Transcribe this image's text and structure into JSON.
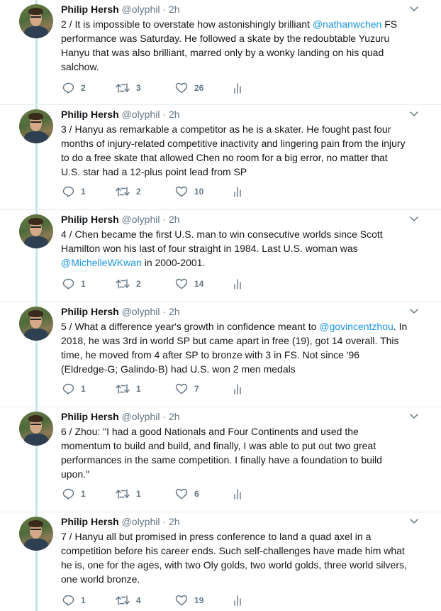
{
  "colors": {
    "thread_line": "#c4e4ec",
    "link": "#1b95e0",
    "meta": "#657786",
    "text": "#14171a"
  },
  "icons": {
    "reply": "reply-icon",
    "retweet": "retweet-icon",
    "like": "heart-icon",
    "analytics": "analytics-icon",
    "menu": "chevron-down-icon"
  },
  "tweets": [
    {
      "name": "Philip Hersh",
      "handle": "@olyphil",
      "dot": "·",
      "time": "2h",
      "text_parts": [
        "2 / It is impossible to overstate how astonishingly brilliant ",
        "@nathanwchen",
        " FS performance was Saturday.  He followed a skate by the redoubtable Yuzuru Hanyu that was also brilliant, marred only by a wonky landing on his quad salchow."
      ],
      "replies": "2",
      "retweets": "3",
      "likes": "26"
    },
    {
      "name": "Philip Hersh",
      "handle": "@olyphil",
      "dot": "·",
      "time": "2h",
      "text_parts": [
        "3 / Hanyu as remarkable a competitor as he is a skater.  He fought past four months of injury-related competitive inactivity and lingering pain from the injury to do a free skate that allowed Chen no room for a big error, no matter that U.S. star had a 12-plus point lead from SP",
        "",
        ""
      ],
      "replies": "1",
      "retweets": "2",
      "likes": "10"
    },
    {
      "name": "Philip Hersh",
      "handle": "@olyphil",
      "dot": "·",
      "time": "2h",
      "text_parts": [
        "4 / Chen became the first U.S. man to win consecutive worlds since Scott Hamilton won his last of four straight in 1984.  Last U.S. woman was ",
        "@MichelleWKwan",
        " in 2000-2001."
      ],
      "replies": "1",
      "retweets": "2",
      "likes": "14"
    },
    {
      "name": "Philip Hersh",
      "handle": "@olyphil",
      "dot": "·",
      "time": "2h",
      "text_parts": [
        "5 / What a difference year's growth in confidence meant to ",
        "@govincentzhou",
        ".  In 2018, he was 3rd in world SP but came apart in free (19), got 14 overall.  This time, he moved from 4 after SP to bronze with 3 in FS.  Not since '96 (Eldredge-G; Galindo-B) had U.S. won 2 men medals"
      ],
      "replies": "1",
      "retweets": "1",
      "likes": "7"
    },
    {
      "name": "Philip Hersh",
      "handle": "@olyphil",
      "dot": "·",
      "time": "2h",
      "text_parts": [
        "6 / Zhou:  \"I had a good Nationals and Four Continents and used the momentum to build and build, and finally, I was able to put out two great performances in the same competition.  I finally have a foundation to build upon.\"",
        "",
        ""
      ],
      "replies": "1",
      "retweets": "1",
      "likes": "6"
    },
    {
      "name": "Philip Hersh",
      "handle": "@olyphil",
      "dot": "·",
      "time": "2h",
      "text_parts": [
        "7 / Hanyu all but promised in press conference to land a quad axel in a competition before his career ends.  Such self-challenges have made him what he is, one for the ages, with two Oly golds, two world golds, three world silvers, one world bronze.",
        "",
        ""
      ],
      "replies": "1",
      "retweets": "4",
      "likes": "19"
    }
  ]
}
